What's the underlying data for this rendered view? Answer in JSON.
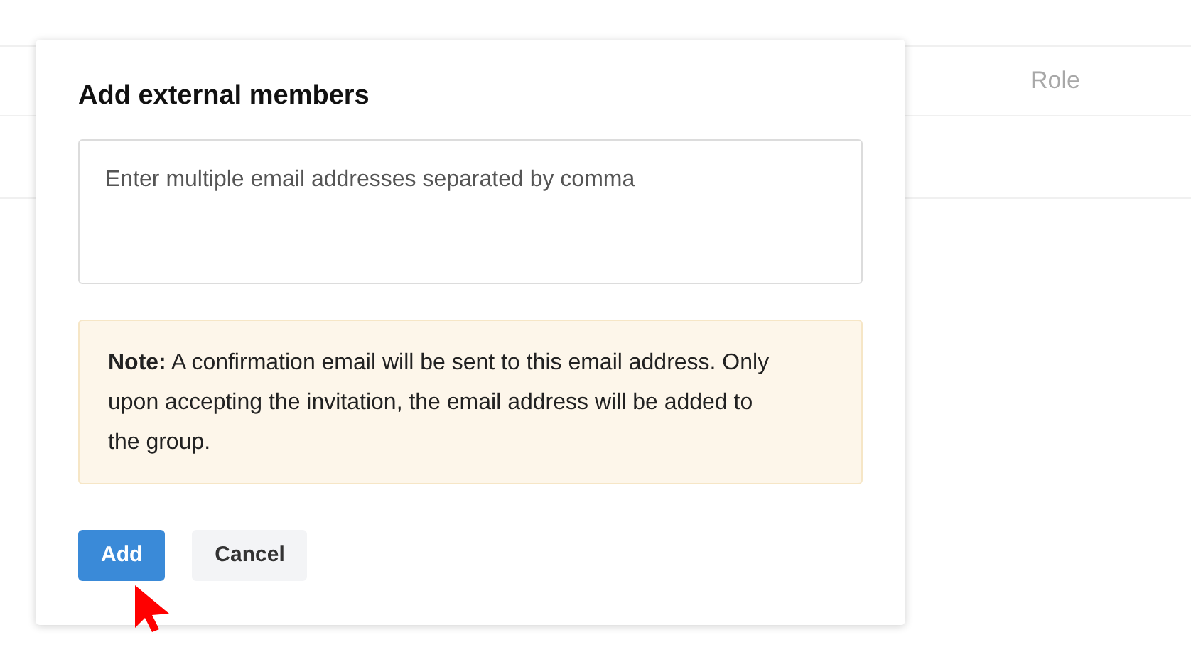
{
  "table": {
    "columns": [
      {
        "label": "Role"
      }
    ]
  },
  "dialog": {
    "title": "Add external members",
    "emails_field": {
      "placeholder": "Enter multiple email addresses separated by comma"
    },
    "note": {
      "label": "Note:",
      "text": "A confirmation email will be sent to this email address. Only upon accepting the invitation, the email address will be added to the group."
    },
    "buttons": [
      {
        "label": "Add",
        "kind": "primary"
      },
      {
        "label": "Cancel",
        "kind": "secondary"
      }
    ]
  }
}
